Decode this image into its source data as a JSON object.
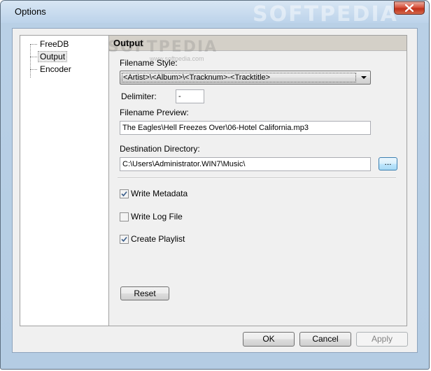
{
  "window": {
    "title": "Options"
  },
  "watermark": {
    "main": "SOFTPEDIA",
    "overlay": "SOFTPEDIA",
    "url": "www.softpedia.com"
  },
  "tree": {
    "items": [
      {
        "label": "FreeDB",
        "selected": false
      },
      {
        "label": "Output",
        "selected": true
      },
      {
        "label": "Encoder",
        "selected": false
      }
    ]
  },
  "panel": {
    "title": "Output",
    "filename_style": {
      "label": "Filename Style:",
      "value": "<Artist>\\<Album>\\<Tracknum>-<Tracktitle>"
    },
    "delimiter": {
      "label": "Delimiter:",
      "value": "-"
    },
    "filename_preview": {
      "label": "Filename Preview:",
      "value": "The Eagles\\Hell Freezes Over\\06-Hotel California.mp3"
    },
    "destination": {
      "label": "Destination Directory:",
      "value": "C:\\Users\\Administrator.WIN7\\Music\\",
      "browse_label": "..."
    },
    "checkboxes": [
      {
        "label": "Write Metadata",
        "checked": true
      },
      {
        "label": "Write Log File",
        "checked": false
      },
      {
        "label": "Create Playlist",
        "checked": true
      }
    ],
    "reset_label": "Reset"
  },
  "footer": {
    "ok_label": "OK",
    "cancel_label": "Cancel",
    "apply_label": "Apply",
    "apply_enabled": false
  }
}
